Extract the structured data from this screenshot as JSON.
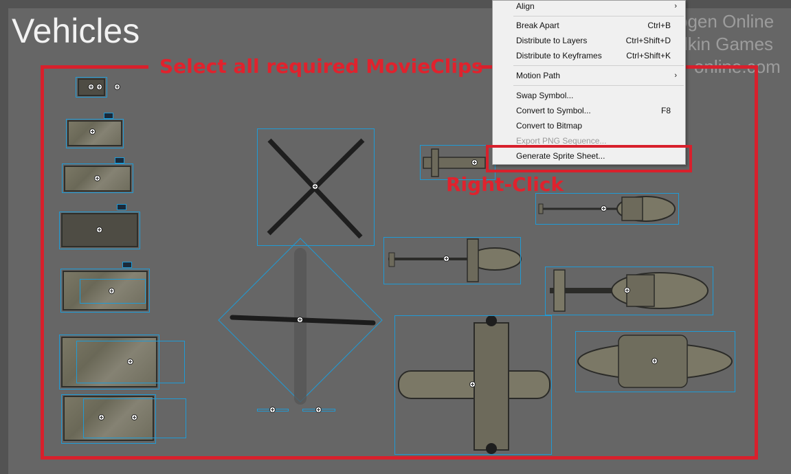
{
  "scene": {
    "title": "Vehicles",
    "watermark": [
      "ogen Online",
      "lkin Games",
      "online.com"
    ]
  },
  "annotations": {
    "select_label": "Select all required MovieClips",
    "right_click_label": "Right-Click"
  },
  "context_menu": {
    "items": [
      {
        "label": "Align",
        "shortcut": "",
        "submenu": true,
        "disabled": false
      },
      {
        "label": "Break Apart",
        "shortcut": "Ctrl+B",
        "submenu": false,
        "disabled": false
      },
      {
        "label": "Distribute to Layers",
        "shortcut": "Ctrl+Shift+D",
        "submenu": false,
        "disabled": false
      },
      {
        "label": "Distribute to Keyframes",
        "shortcut": "Ctrl+Shift+K",
        "submenu": false,
        "disabled": false
      },
      {
        "label": "Motion Path",
        "shortcut": "",
        "submenu": true,
        "disabled": false
      },
      {
        "label": "Swap Symbol...",
        "shortcut": "",
        "submenu": false,
        "disabled": false
      },
      {
        "label": "Convert to Symbol...",
        "shortcut": "F8",
        "submenu": false,
        "disabled": false
      },
      {
        "label": "Convert to Bitmap",
        "shortcut": "",
        "submenu": false,
        "disabled": false
      },
      {
        "label": "Export PNG Sequence...",
        "shortcut": "",
        "submenu": false,
        "disabled": true
      },
      {
        "label": "Generate Sprite Sheet...",
        "shortcut": "",
        "submenu": false,
        "disabled": false
      }
    ],
    "submenu_glyph": "›"
  },
  "colors": {
    "annotation_red": "#d8202c",
    "selection_blue": "#1f9bd6",
    "stage_gray": "#666666"
  },
  "icons": [
    "registration-point-icon",
    "submenu-arrow-icon"
  ]
}
